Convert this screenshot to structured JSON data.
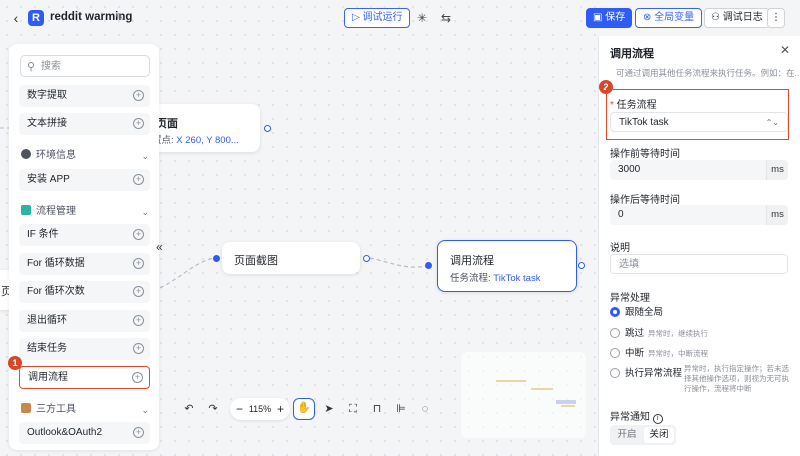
{
  "header": {
    "app_initial": "R",
    "app_title": "reddit warming",
    "debug_run_label": "调试运行",
    "save_label": "保存",
    "global_vars_label": "全局变量",
    "debug_log_label": "调试日志"
  },
  "sidebar": {
    "search_placeholder": "搜索",
    "items_top": [
      "数字提取",
      "文本拼接"
    ],
    "cat_env": "环境信息",
    "env_items": [
      "安装 APP"
    ],
    "cat_flow": "流程管理",
    "flow_items": [
      "IF 条件",
      "For 循环数据",
      "For 循环次数",
      "退出循环",
      "结束任务",
      "调用流程"
    ],
    "cat_tools": "三方工具",
    "tool_items": [
      "Outlook&OAuth2"
    ],
    "badge": "1"
  },
  "canvas": {
    "node_page_title": "页面",
    "node_page_sub_prefix": "置点: ",
    "node_page_sub_value": "X 260, Y 800...",
    "node_partial_left": "页",
    "node_screenshot_title": "页面截图",
    "node_call_title": "调用流程",
    "node_call_sub_prefix": "任务流程: ",
    "node_call_sub_value": "TikTok task",
    "zoom": "115%"
  },
  "panel": {
    "title": "调用流程",
    "description": "可通过调用其他任务流程来执行任务。例如：在...",
    "badge": "2",
    "task_flow_label": "任务流程",
    "task_flow_value": "TikTok task",
    "wait_before_label": "操作前等待时间",
    "wait_before_value": "3000",
    "wait_after_label": "操作后等待时间",
    "wait_after_value": "0",
    "unit": "ms",
    "desc_label": "说明",
    "desc_placeholder": "选填",
    "exception_label": "异常处理",
    "opt_follow": "跟随全局",
    "opt_skip": "跳过",
    "opt_skip_hint": "异常时，继续执行",
    "opt_break": "中断",
    "opt_break_hint": "异常时，中断流程",
    "opt_exec": "执行异常流程",
    "opt_exec_hint": "异常时，执行指定操作；若未选择其他操作选项，则视为无可执行操作，流程将中断",
    "notify_label": "异常通知",
    "notify_on": "开启",
    "notify_off": "关闭"
  },
  "colors": {
    "accent": "#2f5cf6",
    "highlight": "#e0492d"
  }
}
